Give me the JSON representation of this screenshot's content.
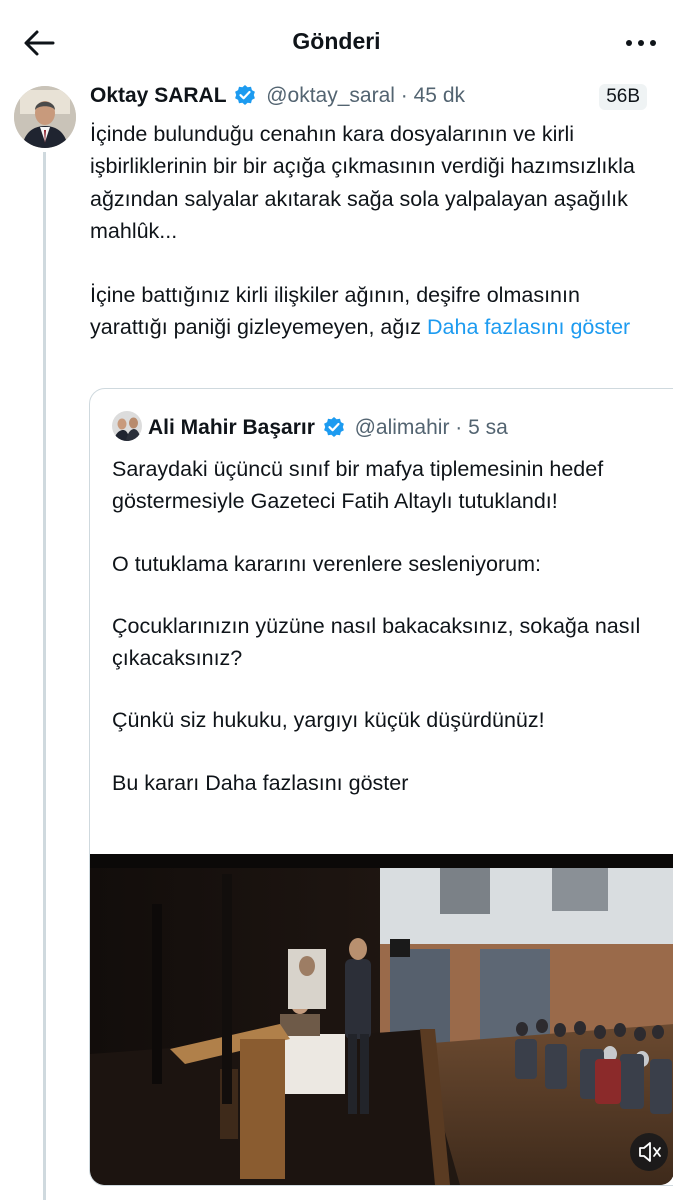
{
  "header": {
    "title": "Gönderi",
    "back_icon": "arrow-left-icon",
    "more_icon": "more-horizontal-icon"
  },
  "tweet": {
    "author_name": "Oktay SARAL",
    "handle": "@oktay_saral",
    "separator": "·",
    "time": "45 dk",
    "badge": "56B",
    "paragraphs": [
      "İçinde bulunduğu cenahın kara dosyalarının ve kirli işbirliklerinin bir bir açığa çıkmasının verdiği hazımsızlıkla ağzından salyalar akıtarak sağa sola yalpalayan aşağılık mahlûk...",
      "İçine battığınız kirli ilişkiler ağının, deşifre olmasının yarattığı paniği gizleyemeyen, ağız"
    ],
    "show_more": "Daha fazlasını göster"
  },
  "quote": {
    "author_name": "Ali Mahir Başarır",
    "handle": "@alimahir",
    "separator": "·",
    "time": "5 sa",
    "paragraphs": [
      "Saraydaki üçüncü sınıf bir mafya tiplemesinin hedef göstermesiyle Gazeteci Fatih Altaylı tutuklandı!",
      "O tutuklama kararını verenlere sesleniyorum:",
      "Çocuklarınızın yüzüne nasıl bakacaksınız, sokağa nasıl çıkacaksınız?",
      "Çünkü siz hukuku, yargıyı küçük düşürdünüz!"
    ],
    "last_line": "Bu kararı",
    "show_more": "Daha fazlasını göster",
    "media_icon": "video-mute-icon"
  },
  "colors": {
    "link": "#1d9bf0",
    "verified": "#1d9bf0",
    "secondary_text": "#536471",
    "thread_line": "#cfd9de"
  }
}
